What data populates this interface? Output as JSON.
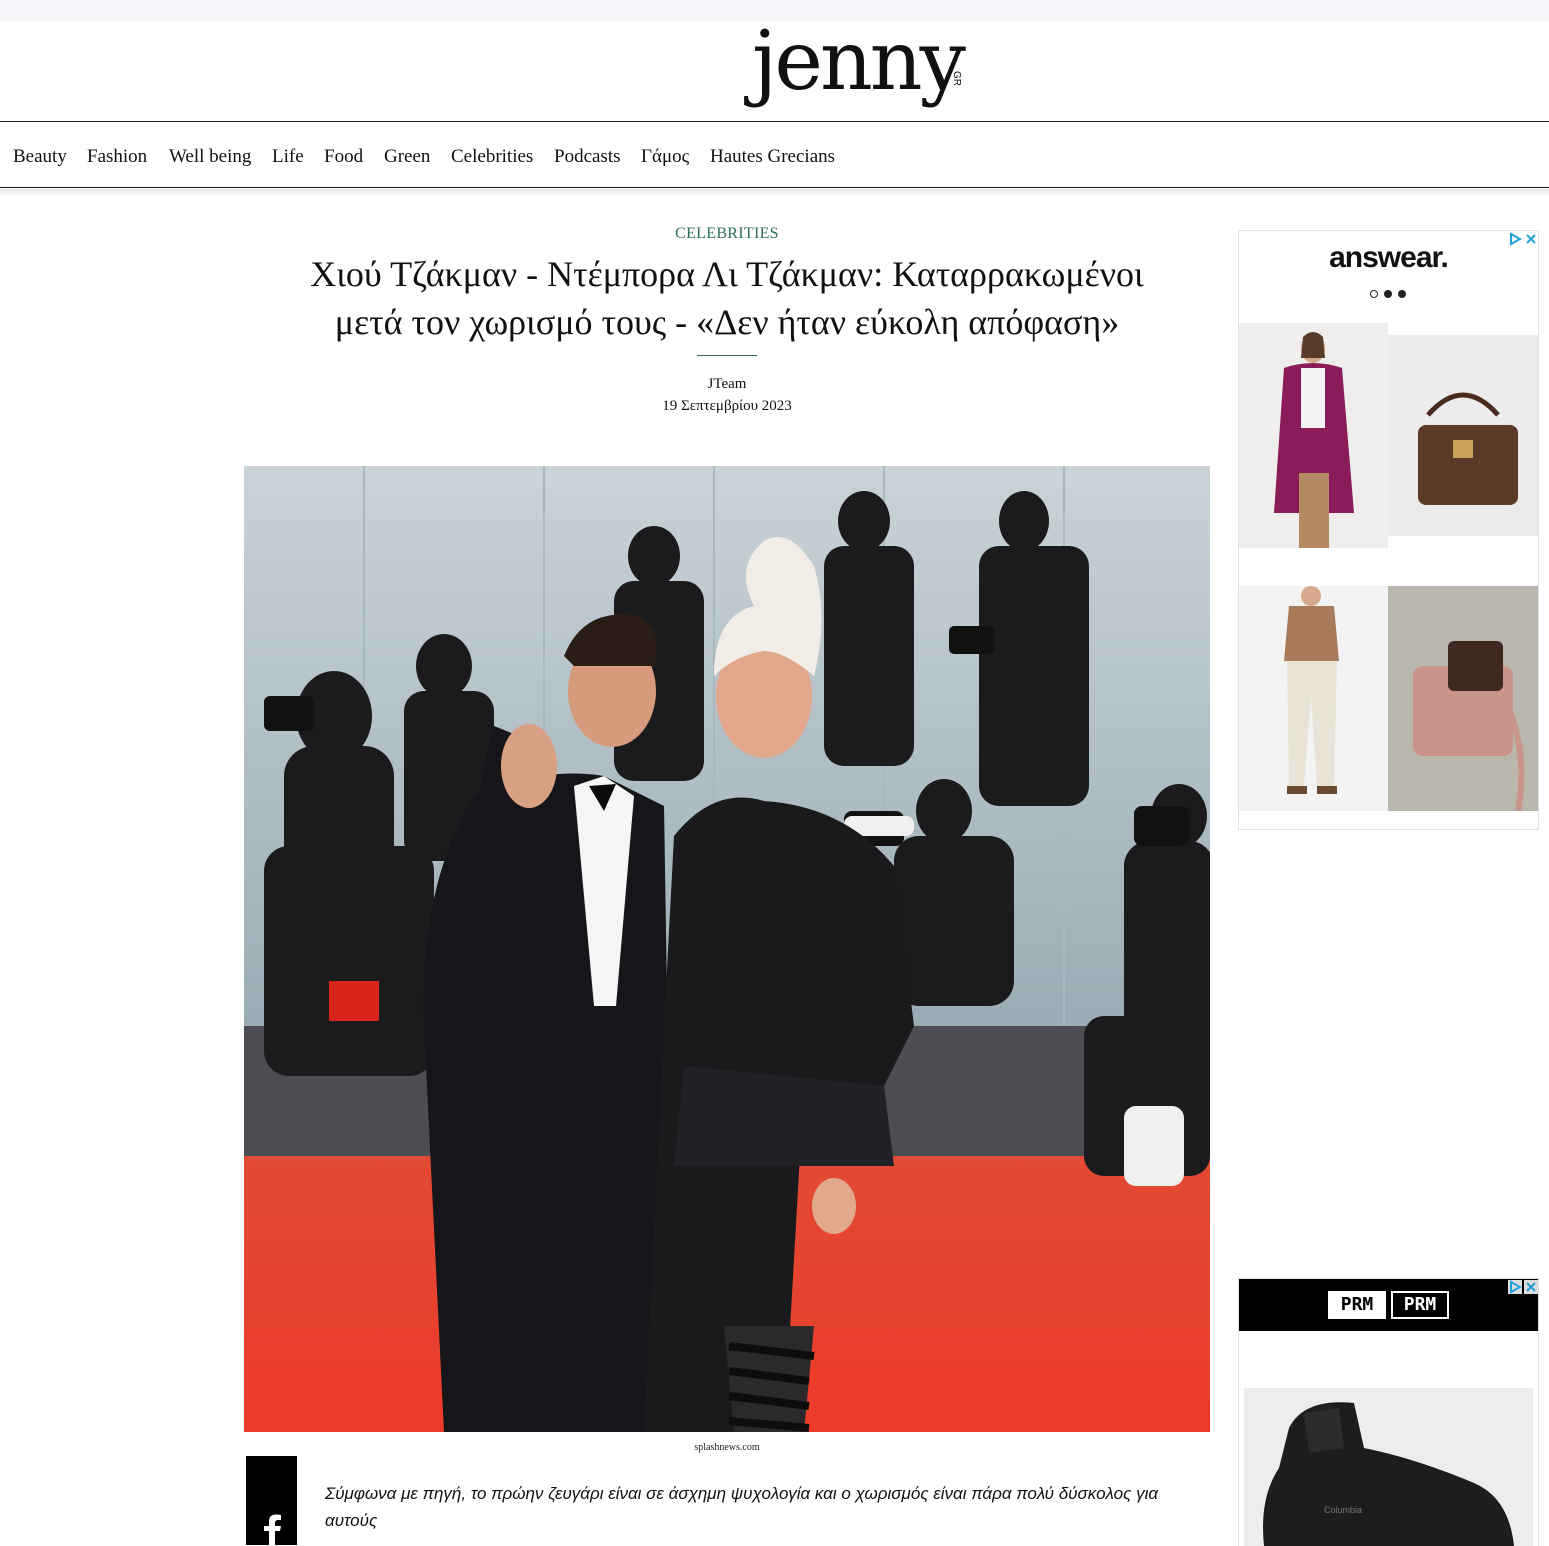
{
  "site": {
    "logo": "jenny",
    "logo_suffix": "GR"
  },
  "nav": {
    "items": [
      "Beauty",
      "Fashion",
      "Well being",
      "Life",
      "Food",
      "Green",
      "Celebrities",
      "Podcasts",
      "Γάμος",
      "Hautes Grecians"
    ]
  },
  "article": {
    "category": "CELEBRITIES",
    "title_line1": "Χιού Τζάκμαν - Ντέμπορα Λι Τζάκμαν: Καταρρακωμένοι",
    "title_line2": "μετά τον χωρισμό τους - «Δεν ήταν εύκολη απόφαση»",
    "author": "JTeam",
    "date": "19 Σεπτεμβρίου 2023",
    "image_credit": "splashnews.com",
    "lead": "Σύμφωνα με πηγή, το πρώην ζευγάρι είναι σε άσχημη ψυχολογία και ο χωρισμός είναι πάρα πολύ δύσκολος για αυτούς"
  },
  "share": {
    "icon": "facebook-icon"
  },
  "ads": {
    "top": {
      "brand": "answear.",
      "carousel_dots": 3,
      "active_dot": 1
    },
    "bottom": {
      "brand_left": "PRM",
      "brand_right": "PRM"
    }
  },
  "colors": {
    "accent": "#2f6d5c",
    "carpet_red": "#e8412c",
    "background": "#ffffff"
  }
}
